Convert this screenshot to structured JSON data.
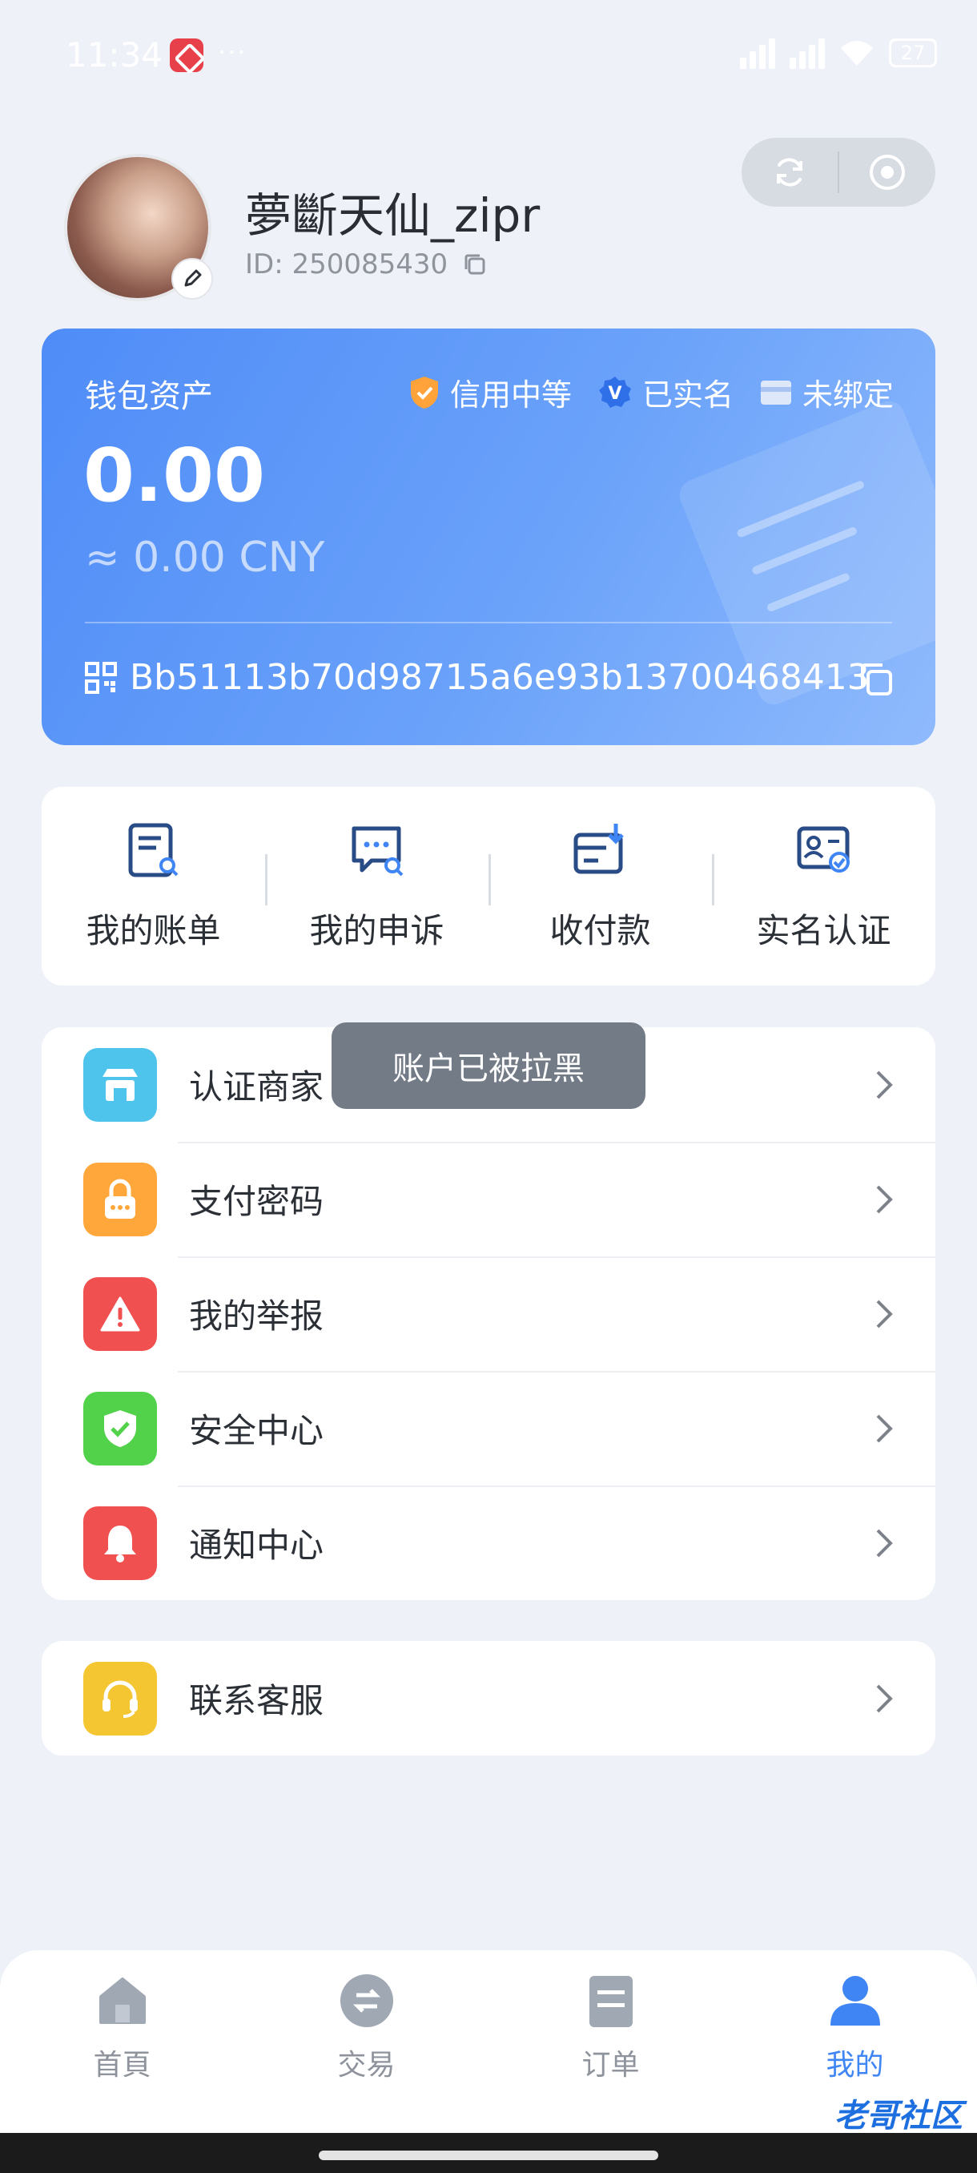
{
  "status_bar": {
    "time": "11:34",
    "dots": "···",
    "battery": "27"
  },
  "profile": {
    "username": "夢斷天仙_zipr",
    "id_text": "ID: 250085430"
  },
  "wallet": {
    "title": "钱包资产",
    "badges": {
      "credit": "信用中等",
      "verified": "已实名",
      "unbound": "未绑定"
    },
    "balance": "0.00",
    "balance_cny": "≈ 0.00 CNY",
    "address": "Bb51113b70d98715a6e93b13700468413"
  },
  "actions": [
    {
      "label": "我的账单",
      "icon": "bill-search-icon"
    },
    {
      "label": "我的申诉",
      "icon": "chat-search-icon"
    },
    {
      "label": "收付款",
      "icon": "receive-payment-icon"
    },
    {
      "label": "实名认证",
      "icon": "id-card-check-icon"
    }
  ],
  "menu": [
    {
      "label": "认证商家",
      "icon": "store-icon",
      "color": "#4ec3ec"
    },
    {
      "label": "支付密码",
      "icon": "lock-icon",
      "color": "#ffa73a"
    },
    {
      "label": "我的举报",
      "icon": "warning-icon",
      "color": "#f05050"
    },
    {
      "label": "安全中心",
      "icon": "shield-check-icon",
      "color": "#52d24a"
    },
    {
      "label": "通知中心",
      "icon": "bell-icon",
      "color": "#f05050"
    }
  ],
  "support": {
    "label": "联系客服",
    "icon": "headset-icon",
    "color": "#f3c632"
  },
  "toast": "账户已被拉黑",
  "nav": [
    {
      "label": "首頁",
      "icon": "home-icon"
    },
    {
      "label": "交易",
      "icon": "exchange-icon"
    },
    {
      "label": "订单",
      "icon": "order-icon"
    },
    {
      "label": "我的",
      "icon": "user-icon",
      "active": true
    }
  ],
  "watermark": "老哥社区",
  "colors": {
    "accent": "#3f86f4",
    "page_bg": "#eef2f8"
  }
}
